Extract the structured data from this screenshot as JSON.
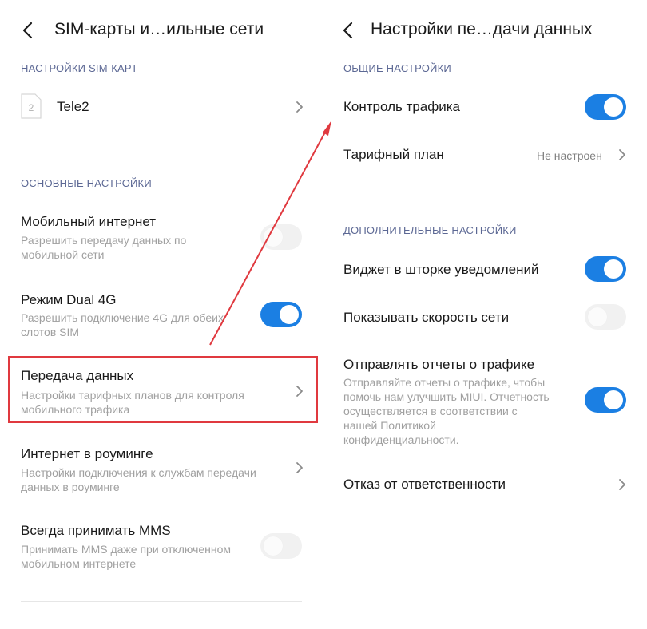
{
  "left": {
    "title": "SIM-карты и…ильные сети",
    "sim_section": "НАСТРОЙКИ SIM-КАРТ",
    "sim": {
      "number": "2",
      "name": "Tele2"
    },
    "main_section": "ОСНОВНЫЕ НАСТРОЙКИ",
    "items": [
      {
        "title": "Мобильный интернет",
        "subtitle": "Разрешить передачу данных по мобильной сети",
        "toggle": false
      },
      {
        "title": "Режим Dual 4G",
        "subtitle": "Разрешить подключение 4G для обеих слотов SIM",
        "toggle": true
      },
      {
        "title": "Передача данных",
        "subtitle": "Настройки тарифных планов для контроля мобильного трафика"
      },
      {
        "title": "Интернет в роуминге",
        "subtitle": "Настройки подключения к службам передачи данных в роуминге"
      },
      {
        "title": "Всегда принимать MMS",
        "subtitle": "Принимать MMS даже при отключенном мобильном интернете",
        "toggle": false
      }
    ]
  },
  "right": {
    "title": "Настройки пе…дачи данных",
    "general_section": "ОБЩИЕ НАСТРОЙКИ",
    "traffic_control": {
      "title": "Контроль трафика",
      "toggle": true
    },
    "tariff_plan": {
      "title": "Тарифный план",
      "value": "Не настроен"
    },
    "extra_section": "ДОПОЛНИТЕЛЬНЫЕ НАСТРОЙКИ",
    "widget": {
      "title": "Виджет в шторке уведомлений",
      "toggle": true
    },
    "speed": {
      "title": "Показывать скорость сети",
      "toggle": false
    },
    "reports": {
      "title": "Отправлять отчеты о трафике",
      "subtitle": "Отправляйте отчеты о трафике, чтобы помочь нам улучшить MIUI. Отчетность осуществляется в соответствии с нашей Политикой конфиденциальности.",
      "toggle": true
    },
    "disclaimer": {
      "title": "Отказ от ответственности"
    }
  },
  "colors": {
    "accent": "#1b7fe3",
    "highlight": "#e0393f",
    "section": "#5c6894"
  },
  "icons": [
    "back-arrow-icon",
    "chevron-right-icon",
    "sim-card-icon"
  ]
}
